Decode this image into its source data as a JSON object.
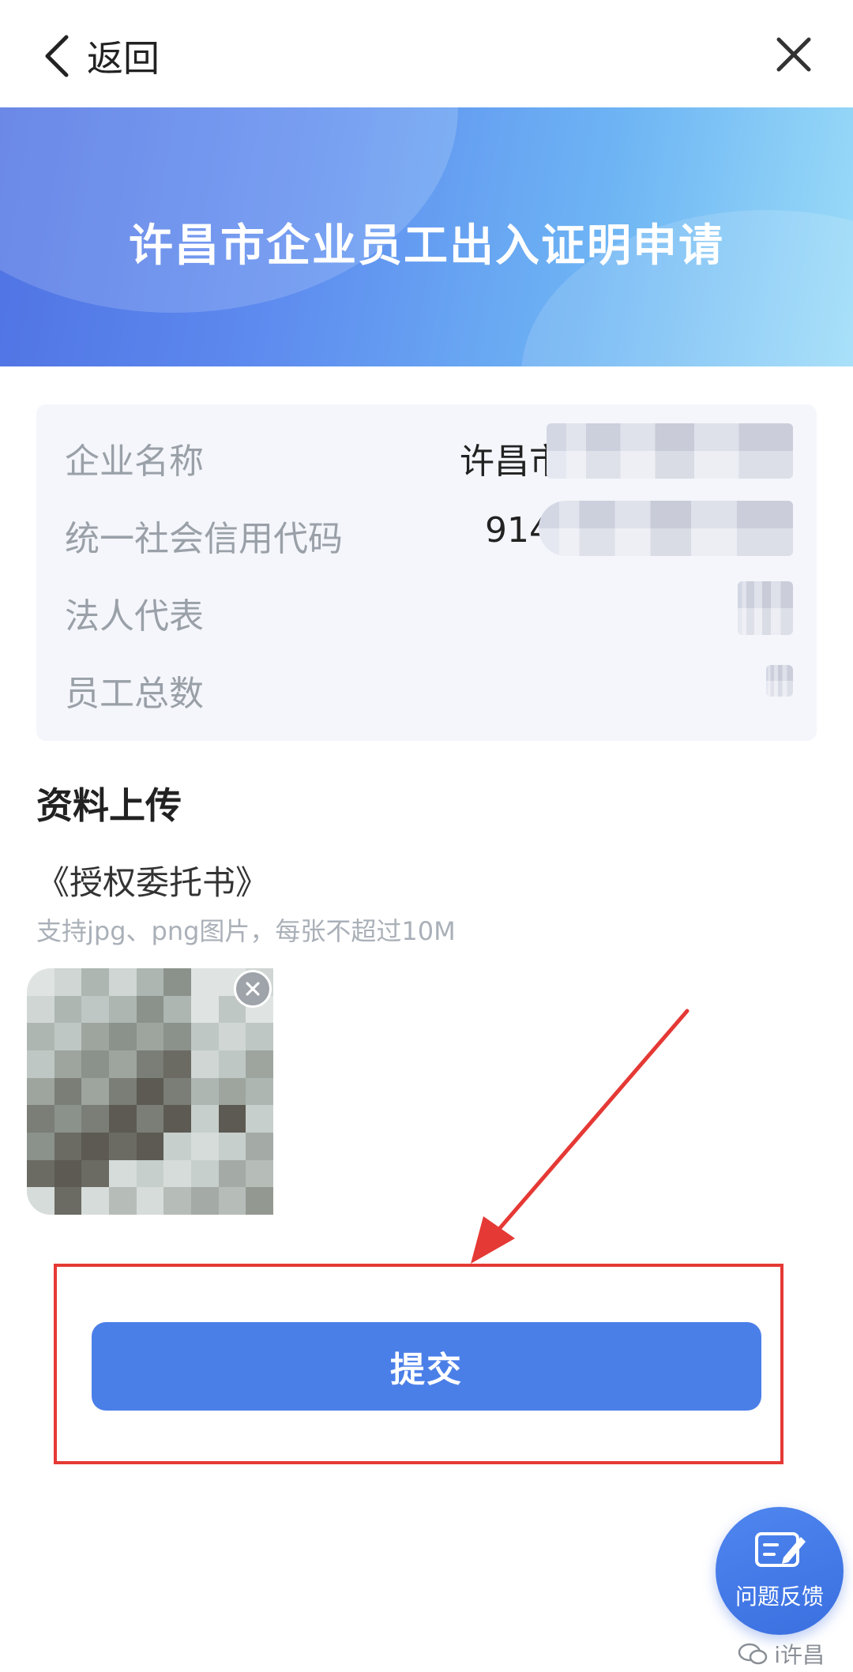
{
  "nav": {
    "back_label": "返回"
  },
  "banner": {
    "title": "许昌市企业员工出入证明申请"
  },
  "info": [
    {
      "key": "企业名称",
      "value_prefix": "许昌市"
    },
    {
      "key": "统一社会信用代码",
      "value_prefix": "914"
    },
    {
      "key": "法人代表",
      "value_prefix": ""
    },
    {
      "key": "员工总数",
      "value_prefix": ""
    }
  ],
  "upload": {
    "section_title": "资料上传",
    "doc_name": "《授权委托书》",
    "hint": "支持jpg、png图片，每张不超过10M"
  },
  "actions": {
    "submit_label": "提交"
  },
  "feedback": {
    "label": "问题反馈"
  },
  "watermark": {
    "text": "i许昌"
  },
  "colors": {
    "primary": "#4b7fe8",
    "highlight_red": "#e53935",
    "banner_start": "#4f72e3",
    "banner_end": "#9bdcf8"
  }
}
